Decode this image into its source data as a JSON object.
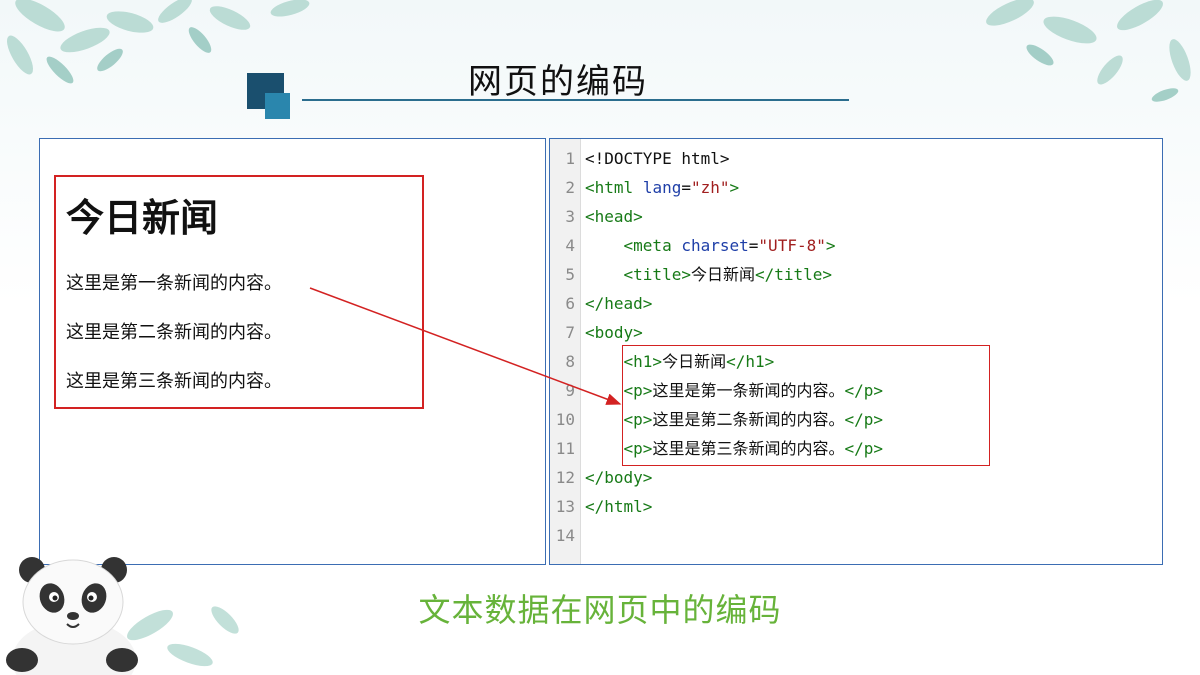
{
  "slide": {
    "title": "网页的编码",
    "caption": "文本数据在网页中的编码",
    "colors": {
      "title_square_dark": "#1a4f6e",
      "title_square_light": "#2a86ad",
      "highlight_box": "#d32222",
      "caption": "#67b33a",
      "panel_border": "#3b6db3"
    }
  },
  "preview": {
    "heading": "今日新闻",
    "paragraphs": [
      "这里是第一条新闻的内容。",
      "这里是第二条新闻的内容。",
      "这里是第三条新闻的内容。"
    ]
  },
  "code": {
    "line_numbers": [
      "1",
      "2",
      "3",
      "4",
      "5",
      "6",
      "7",
      "8",
      "9",
      "10",
      "11",
      "12",
      "13",
      "14"
    ],
    "lines": {
      "l1": "<!DOCTYPE html>",
      "l2_open": "<html",
      "l2_attr": "lang",
      "l2_eq": "=",
      "l2_val": "\"zh\"",
      "l2_close": ">",
      "l3": "<head>",
      "l4_open": "<meta",
      "l4_attr": "charset",
      "l4_eq": "=",
      "l4_val": "\"UTF-8\"",
      "l4_close": ">",
      "l5_open": "<title>",
      "l5_text": "今日新闻",
      "l5_close": "</title>",
      "l6": "</head>",
      "l7": "<body>",
      "l8_open": "<h1>",
      "l8_text": "今日新闻",
      "l8_close": "</h1>",
      "l9_open": "<p>",
      "l9_text": "这里是第一条新闻的内容。",
      "l9_close": "</p>",
      "l10_open": "<p>",
      "l10_text": "这里是第二条新闻的内容。",
      "l10_close": "</p>",
      "l11_open": "<p>",
      "l11_text": "这里是第三条新闻的内容。",
      "l11_close": "</p>",
      "l12": "</body>",
      "l13": "</html>"
    }
  },
  "decorations": [
    "leaves",
    "panda"
  ]
}
